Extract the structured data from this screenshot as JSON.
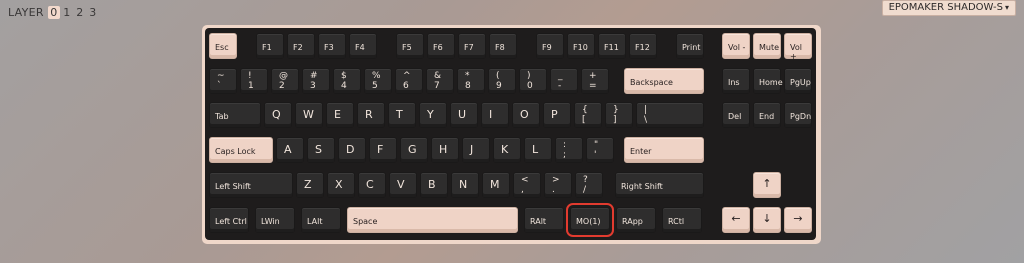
{
  "layer_selector": {
    "label": "LAYER",
    "options": [
      "0",
      "1",
      "2",
      "3"
    ],
    "active": "0"
  },
  "device_select": {
    "value": "EPOMAKER SHADOW-S",
    "icon": "chevron-down-icon"
  },
  "colors": {
    "light_keycap": "#efd3c6",
    "dark_keycap": "#2e2d2d",
    "plate": "#1e1c1c",
    "selection": "#e23b2f"
  },
  "selected_key": "MO(1)",
  "keys": {
    "esc": "Esc",
    "f1": "F1",
    "f2": "F2",
    "f3": "F3",
    "f4": "F4",
    "f5": "F5",
    "f6": "F6",
    "f7": "F7",
    "f8": "F8",
    "f9": "F9",
    "f10": "F10",
    "f11": "F11",
    "f12": "F12",
    "print": "Print",
    "vol_down": "Vol -",
    "mute": "Mute",
    "vol_up": "Vol +",
    "grave": "~\n`",
    "n1": "!\n1",
    "n2": "@\n2",
    "n3": "#\n3",
    "n4": "$\n4",
    "n5": "%\n5",
    "n6": "^\n6",
    "n7": "&\n7",
    "n8": "*\n8",
    "n9": "(\n9",
    "n0": ")\n0",
    "minus": "_\n-",
    "equal": "+\n=",
    "backspace": "Backspace",
    "ins": "Ins",
    "home": "Home",
    "pgup": "PgUp",
    "tab": "Tab",
    "q": "Q",
    "w": "W",
    "e": "E",
    "r": "R",
    "t": "T",
    "y": "Y",
    "u": "U",
    "i": "I",
    "o": "O",
    "p": "P",
    "lbracket": "{\n[",
    "rbracket": "}\n]",
    "backslash": "|\n\\",
    "del": "Del",
    "end": "End",
    "pgdn": "PgDn",
    "capslock": "Caps Lock",
    "a": "A",
    "s": "S",
    "d": "D",
    "f": "F",
    "g": "G",
    "h": "H",
    "j": "J",
    "k": "K",
    "l": "L",
    "semicolon": ":\n;",
    "quote": "\"\n'",
    "enter": "Enter",
    "lshift": "Left Shift",
    "z": "Z",
    "x": "X",
    "c": "C",
    "v": "V",
    "b": "B",
    "n": "N",
    "m": "M",
    "comma": "<\n,",
    "period": ">\n.",
    "slash": "?\n/",
    "rshift": "Right Shift",
    "up": "↑",
    "lctrl": "Left Ctrl",
    "lwin": "LWin",
    "lalt": "LAlt",
    "space": "Space",
    "ralt": "RAlt",
    "mo1": "MO(1)",
    "rapp": "RApp",
    "rctl": "RCtl",
    "left": "←",
    "down": "↓",
    "right": "→"
  }
}
